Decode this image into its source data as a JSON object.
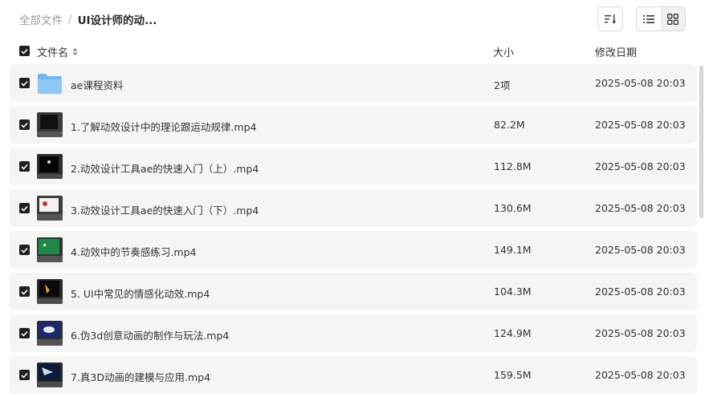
{
  "breadcrumb": {
    "root": "全部文件",
    "separator": "/",
    "current": "UI设计师的动..."
  },
  "table": {
    "headers": {
      "name": "文件名",
      "size": "大小",
      "modified": "修改日期"
    },
    "rows": [
      {
        "name": "ae课程资料",
        "size": "2项",
        "modified": "2025-05-08 20:03",
        "kind": "folder"
      },
      {
        "name": "1.了解动效设计中的理论跟运动规律.mp4",
        "size": "82.2M",
        "modified": "2025-05-08 20:03",
        "kind": "video"
      },
      {
        "name": "2.动效设计工具ae的快速入门（上）.mp4",
        "size": "112.8M",
        "modified": "2025-05-08 20:03",
        "kind": "video"
      },
      {
        "name": "3.动效设计工具ae的快速入门（下）.mp4",
        "size": "130.6M",
        "modified": "2025-05-08 20:03",
        "kind": "video"
      },
      {
        "name": "4.动效中的节奏感练习.mp4",
        "size": "149.1M",
        "modified": "2025-05-08 20:03",
        "kind": "video"
      },
      {
        "name": "5. UI中常见的情感化动效.mp4",
        "size": "104.3M",
        "modified": "2025-05-08 20:03",
        "kind": "video"
      },
      {
        "name": "6.伪3d创意动画的制作与玩法.mp4",
        "size": "124.9M",
        "modified": "2025-05-08 20:03",
        "kind": "video"
      },
      {
        "name": "7.真3D动画的建模与应用.mp4",
        "size": "159.5M",
        "modified": "2025-05-08 20:03",
        "kind": "video"
      }
    ]
  },
  "icons": {
    "sort": "sort-icon",
    "list_view": "list-view-icon",
    "grid_view": "grid-view-icon",
    "folder": "folder-icon",
    "checkbox": "checkbox-checked-icon"
  },
  "colors": {
    "row_bg": "#f5f5f5",
    "checkbox": "#1f1f1f",
    "folder": "#7cc0f5"
  }
}
